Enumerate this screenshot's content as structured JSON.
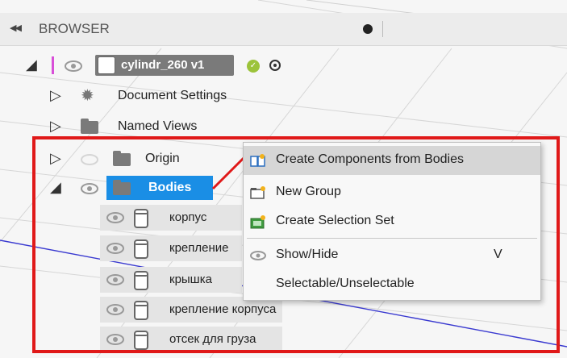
{
  "header": {
    "title": "BROWSER",
    "collapse_glyph": "◀◀"
  },
  "component": {
    "name": "cylindr_260 v1"
  },
  "tree": {
    "document_settings": "Document Settings",
    "named_views": "Named Views",
    "origin": "Origin",
    "bodies": "Bodies"
  },
  "bodies": [
    "корпус",
    "крепление",
    "крышка",
    "крепление корпуса",
    "отсек для груза"
  ],
  "context_menu": {
    "items": [
      {
        "label": "Create Components from Bodies",
        "icon": "create-components-icon",
        "highlighted": true
      },
      {
        "label": "New Group",
        "icon": "new-group-icon"
      },
      {
        "label": "Create Selection Set",
        "icon": "selection-set-icon"
      },
      {
        "label": "Show/Hide",
        "icon": "eye-icon",
        "shortcut": "V"
      },
      {
        "label": "Selectable/Unselectable",
        "icon": ""
      }
    ]
  },
  "colors": {
    "highlight": "#1a8ee5",
    "annotation": "#e01919",
    "accent_yellow": "#f2b21b"
  }
}
